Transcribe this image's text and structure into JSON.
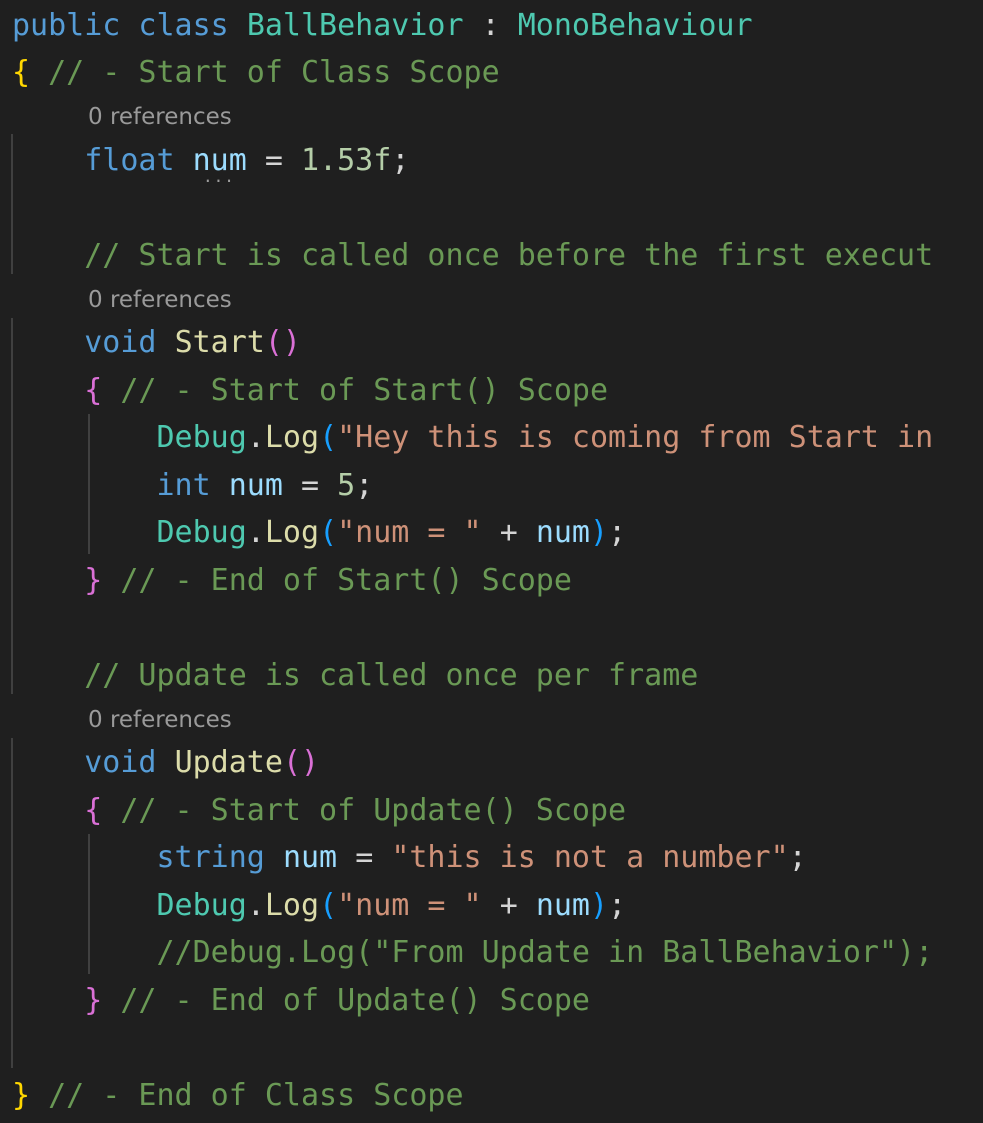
{
  "editor": {
    "codelens": {
      "references": "0 references"
    },
    "lines": {
      "l1": {
        "kw": "public class",
        "cls": "BallBehavior",
        "colon": ":",
        "base": "MonoBehaviour"
      },
      "l2": {
        "brace": "{",
        "comment": "// - Start of Class Scope"
      },
      "l3": {
        "type": "float",
        "name": "num",
        "eq": "=",
        "value": "1.53f",
        "semi": ";"
      },
      "l4": {
        "comment": "// Start is called once before the first execut"
      },
      "l5": {
        "kw": "void",
        "fn": "Start",
        "paren": "()"
      },
      "l6": {
        "brace": "{",
        "comment": "// - Start of Start() Scope"
      },
      "l7": {
        "cls": "Debug",
        "dot": ".",
        "fn": "Log",
        "paren": "(",
        "str": "\"Hey this is coming from Start in"
      },
      "l8": {
        "type": "int",
        "name": "num",
        "eq": "=",
        "value": "5",
        "semi": ";"
      },
      "l9": {
        "cls": "Debug",
        "dot": ".",
        "fn": "Log",
        "open": "(",
        "str": "\"num = \"",
        "plus": "+",
        "name": "num",
        "close": ")",
        "semi": ";"
      },
      "l10": {
        "brace": "}",
        "comment": "// - End of Start() Scope"
      },
      "l11": {
        "comment": "// Update is called once per frame"
      },
      "l12": {
        "kw": "void",
        "fn": "Update",
        "paren": "()"
      },
      "l13": {
        "brace": "{",
        "comment": "// - Start of Update() Scope"
      },
      "l14": {
        "type": "string",
        "name": "num",
        "eq": "=",
        "str": "\"this is not a number\"",
        "semi": ";"
      },
      "l15": {
        "cls": "Debug",
        "dot": ".",
        "fn": "Log",
        "open": "(",
        "str": "\"num = \"",
        "plus": "+",
        "name": "num",
        "close": ")",
        "semi": ";"
      },
      "l16": {
        "comment": "//Debug.Log(\"From Update in BallBehavior\");"
      },
      "l17": {
        "brace": "}",
        "comment": "// - End of Update() Scope"
      },
      "l18": {
        "brace": "}",
        "comment": "// - End of Class Scope"
      }
    },
    "hint": {
      "dots": "..."
    }
  }
}
